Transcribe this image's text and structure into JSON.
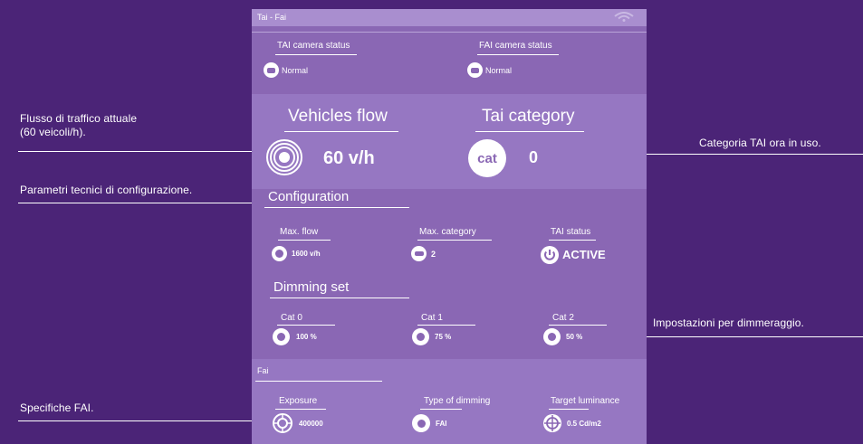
{
  "annotations": {
    "flow_line1": "Flusso di traffico attuale",
    "flow_line2": "(60 veicoli/h).",
    "config": "Parametri tecnici di configurazione.",
    "fai": "Specifiche FAI.",
    "category": "Categoria TAI ora in uso.",
    "dimming": "Impostazioni per dimmeraggio."
  },
  "panel": {
    "title": "Tai - Fai",
    "camera": {
      "tai_label": "TAI camera status",
      "tai_value": "Normal",
      "fai_label": "FAI camera status",
      "fai_value": "Normal"
    },
    "flow": {
      "title": "Vehicles flow",
      "value": "60 v/h"
    },
    "category": {
      "title": "Tai category",
      "icon_text": "cat",
      "value": "0"
    },
    "configuration": {
      "title": "Configuration",
      "max_flow_label": "Max. flow",
      "max_flow_value": "1600 v/h",
      "max_category_label": "Max. category",
      "max_category_value": "2",
      "tai_status_label": "TAI status",
      "tai_status_value": "ACTIVE"
    },
    "dimming": {
      "title": "Dimming set",
      "items": [
        {
          "label": "Cat 0",
          "value": "100 %"
        },
        {
          "label": "Cat 1",
          "value": "75 %"
        },
        {
          "label": "Cat 2",
          "value": "50 %"
        }
      ]
    },
    "fai": {
      "title": "Fai",
      "exposure_label": "Exposure",
      "exposure_value": "400000",
      "dimming_type_label": "Type of dimming",
      "dimming_type_value": "FAI",
      "target_label": "Target luminance",
      "target_value": "0.5 Cd/m2"
    }
  },
  "colors": {
    "background": "#4b2477",
    "panel": "#8a67b4",
    "band": "#9677c2",
    "text": "#ffffff"
  }
}
